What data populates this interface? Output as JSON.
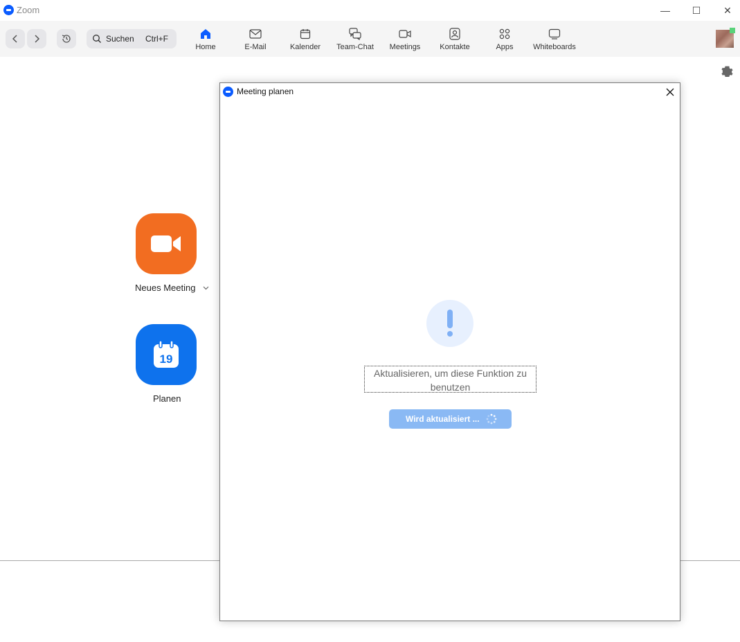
{
  "window": {
    "title": "Zoom",
    "controls": {
      "minimize": "—",
      "maximize": "☐",
      "close": "✕"
    }
  },
  "toolbar": {
    "search": {
      "label": "Suchen",
      "shortcut": "Ctrl+F"
    },
    "tabs": [
      {
        "label": "Home",
        "icon": "home-icon",
        "active": true
      },
      {
        "label": "E-Mail",
        "icon": "mail-icon"
      },
      {
        "label": "Kalender",
        "icon": "calendar-icon"
      },
      {
        "label": "Team-Chat",
        "icon": "chat-icon"
      },
      {
        "label": "Meetings",
        "icon": "video-icon"
      },
      {
        "label": "Kontakte",
        "icon": "contacts-icon"
      },
      {
        "label": "Apps",
        "icon": "apps-icon"
      },
      {
        "label": "Whiteboards",
        "icon": "whiteboard-icon"
      }
    ]
  },
  "home": {
    "new_meeting_label": "Neues Meeting",
    "schedule_label": "Planen",
    "calendar_day": "19"
  },
  "dialog": {
    "title": "Meeting planen",
    "close": "✕",
    "message": "Aktualisieren, um diese Funktion zu benutzen",
    "button_label": "Wird aktualisiert ..."
  },
  "colors": {
    "accent": "#0b5cff",
    "orange": "#f26d21",
    "blue": "#0e72ed",
    "button_disabled": "#8ab9f4",
    "alert_bg": "#e7f0fe"
  }
}
